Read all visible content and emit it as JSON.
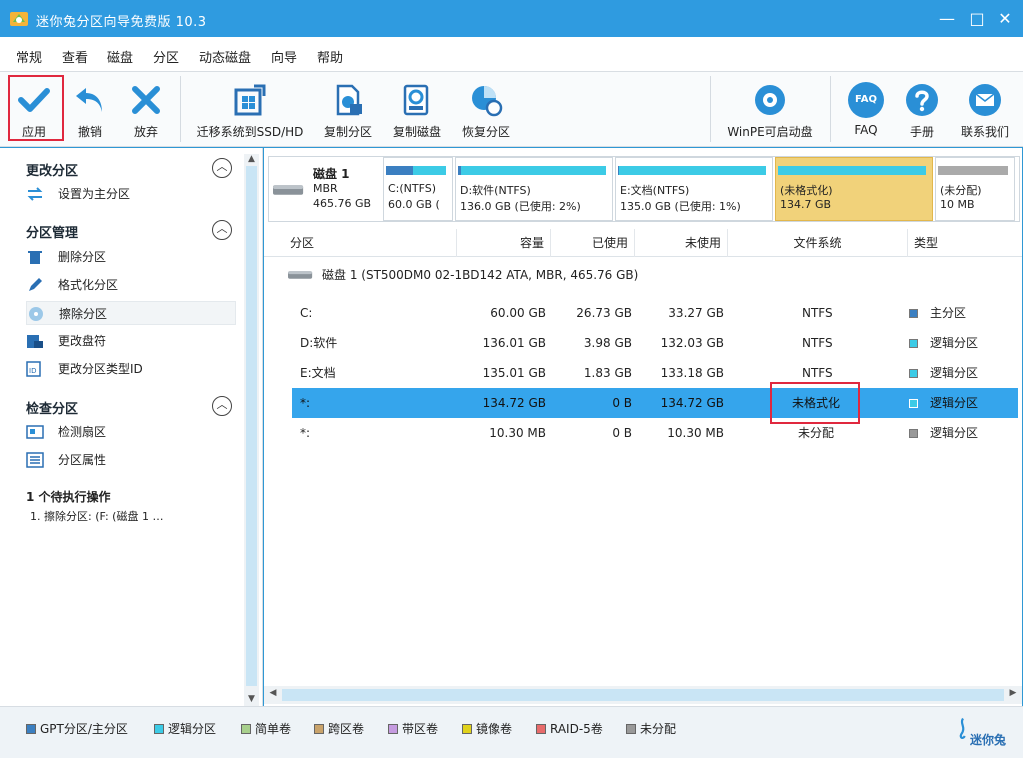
{
  "window": {
    "title": "迷你兔分区向导免费版 10.3",
    "minimize": "—",
    "maximize": "□",
    "close": "✕"
  },
  "menu": [
    "常规",
    "查看",
    "磁盘",
    "分区",
    "动态磁盘",
    "向导",
    "帮助"
  ],
  "toolbar": {
    "apply": "应用",
    "undo": "撤销",
    "discard": "放弃",
    "migrate": "迁移系统到SSD/HD",
    "copy_partition": "复制分区",
    "copy_disk": "复制磁盘",
    "recover": "恢复分区",
    "winpe": "WinPE可启动盘",
    "faq_icon_text": "FAQ",
    "faq": "FAQ",
    "manual": "手册",
    "contact": "联系我们"
  },
  "sidebar": {
    "sections": [
      {
        "title": "更改分区",
        "items": [
          "设置为主分区"
        ]
      },
      {
        "title": "分区管理",
        "items": [
          "删除分区",
          "格式化分区",
          "擦除分区",
          "更改盘符",
          "更改分区类型ID"
        ]
      },
      {
        "title": "检查分区",
        "items": [
          "检测扇区",
          "分区属性"
        ]
      }
    ],
    "pending_title": "1 个待执行操作",
    "pending_item": "1. 擦除分区: (F: (磁盘 1 …"
  },
  "diskmap": {
    "disk_name": "磁盘 1",
    "disk_type": "MBR",
    "disk_size": "465.76 GB",
    "partitions": [
      {
        "name": "C:(NTFS)",
        "size": "60.0 GB (",
        "used_fraction": 0.45
      },
      {
        "name": "D:软件(NTFS)",
        "size": "136.0 GB (已使用: 2%)",
        "used_fraction": 0.02
      },
      {
        "name": "E:文档(NTFS)",
        "size": "135.0 GB (已使用: 1%)",
        "used_fraction": 0.01
      },
      {
        "name": "(未格式化)",
        "size": "134.7 GB",
        "used_fraction": 0
      },
      {
        "name": "(未分配)",
        "size": "10 MB",
        "used_fraction": 0
      }
    ]
  },
  "table": {
    "headers": [
      "分区",
      "容量",
      "已使用",
      "未使用",
      "文件系统",
      "类型"
    ],
    "disk_row": "磁盘 1 (ST500DM0 02-1BD142 ATA, MBR, 465.76 GB)",
    "rows": [
      {
        "name": "C:",
        "capacity": "60.00 GB",
        "used": "26.73 GB",
        "unused": "33.27 GB",
        "fs": "NTFS",
        "type": "主分区",
        "color": "#3b7fc1"
      },
      {
        "name": "D:软件",
        "capacity": "136.01 GB",
        "used": "3.98 GB",
        "unused": "132.03 GB",
        "fs": "NTFS",
        "type": "逻辑分区",
        "color": "#3ccbe6"
      },
      {
        "name": "E:文档",
        "capacity": "135.01 GB",
        "used": "1.83 GB",
        "unused": "133.18 GB",
        "fs": "NTFS",
        "type": "逻辑分区",
        "color": "#3ccbe6"
      },
      {
        "name": "*:",
        "capacity": "134.72 GB",
        "used": "0 B",
        "unused": "134.72 GB",
        "fs": "未格式化",
        "type": "逻辑分区",
        "color": "#3ccbe6"
      },
      {
        "name": "*:",
        "capacity": "10.30 MB",
        "used": "0 B",
        "unused": "10.30 MB",
        "fs": "未分配",
        "type": "逻辑分区",
        "color": "#999999"
      }
    ]
  },
  "legend": [
    {
      "label": "GPT分区/主分区",
      "color": "#3b7fc1"
    },
    {
      "label": "逻辑分区",
      "color": "#3ccbe6"
    },
    {
      "label": "简单卷",
      "color": "#a8d08d"
    },
    {
      "label": "跨区卷",
      "color": "#c9a36b"
    },
    {
      "label": "带区卷",
      "color": "#c59be0"
    },
    {
      "label": "镜像卷",
      "color": "#e0d21c"
    },
    {
      "label": "RAID-5卷",
      "color": "#e86b6b"
    },
    {
      "label": "未分配",
      "color": "#999999"
    }
  ],
  "brand": "迷你兔"
}
